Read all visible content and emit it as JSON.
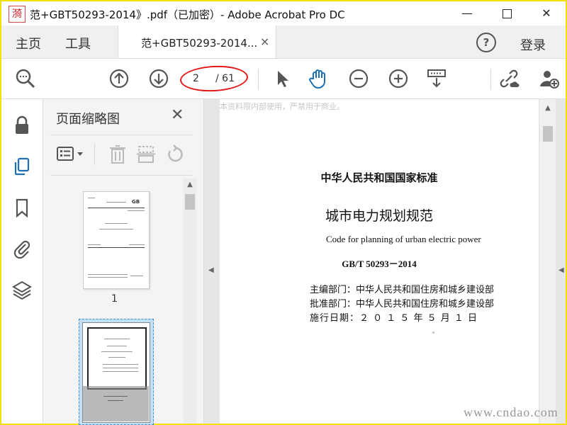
{
  "window": {
    "title": "范+GBT50293-2014》.pdf（已加密）- Adobe Acrobat Pro DC",
    "logo_char": "漪",
    "minimize": "—",
    "close": "✕"
  },
  "tabs": {
    "home": "主页",
    "tools": "工具",
    "document": "范+GBT50293-2014...",
    "document_close": "×",
    "help": "?",
    "sign_in": "登录"
  },
  "toolbar": {
    "current_page": "2",
    "total_pages": "/ 61"
  },
  "thumbnail_panel": {
    "title": "页面缩略图",
    "close": "✕",
    "page1_label": "1"
  },
  "document": {
    "watermark_top": "本资料限内部使用，严禁用于商业。",
    "organization": "中华人民共和国国家标准",
    "title": "城市电力规划规范",
    "title_en": "Code for planning of urban electric power",
    "code": "GB/T 50293－2014",
    "editor_row": "主编部门：中华人民共和国住房和城乡建设部",
    "approver_row": "批准部门：中华人民共和国住房和城乡建设部",
    "effective_row": "施行日期：２ ０ １ ５  年  ５  月  １  日",
    "watermark_bottom": "www.cndao.com"
  },
  "colors": {
    "accent_blue": "#1f6fb5",
    "annotation_red": "#e21818",
    "frame_yellow": "#f2e200"
  }
}
